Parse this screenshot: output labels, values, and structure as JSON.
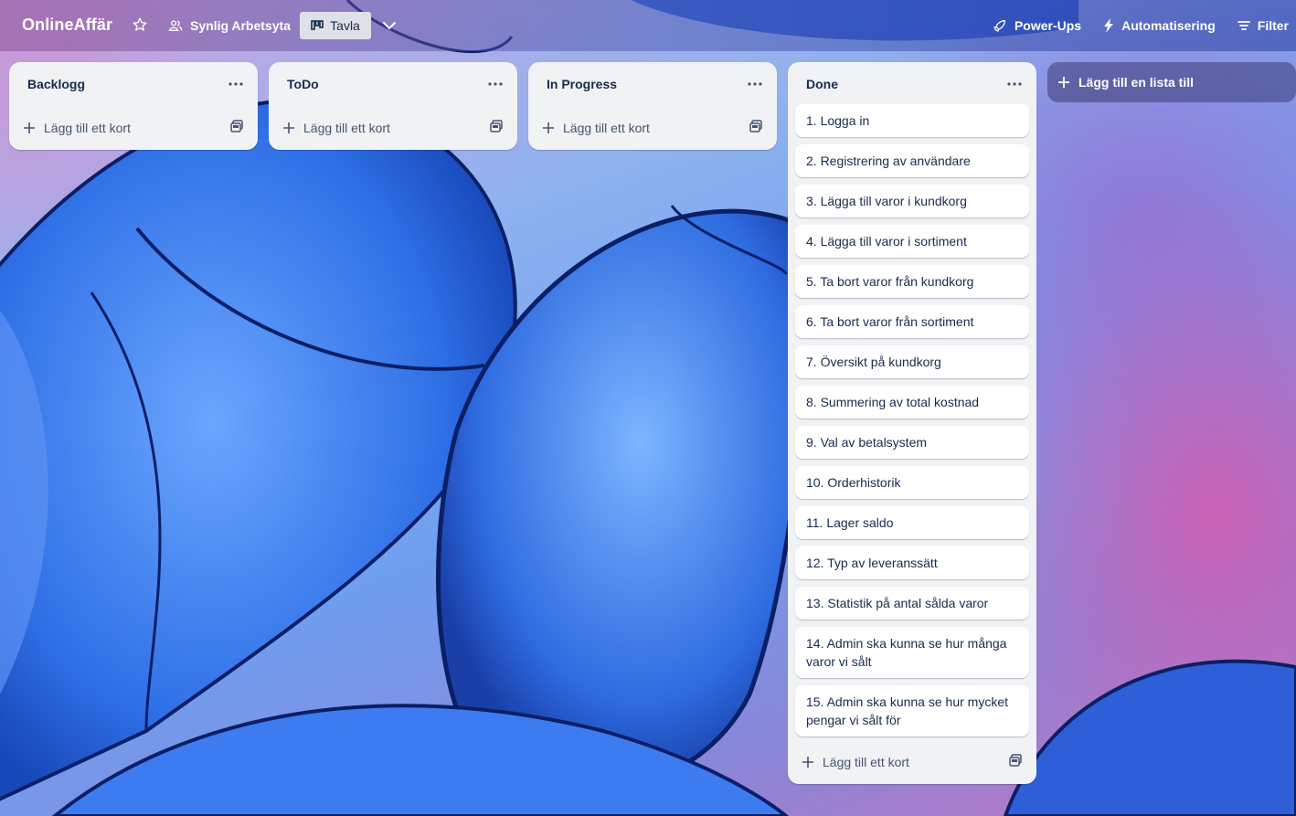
{
  "header": {
    "board_title": "OnlineAffär",
    "visibility_label": "Synlig Arbetsyta",
    "view_label": "Tavla",
    "powerups_label": "Power-Ups",
    "automation_label": "Automatisering",
    "filter_label": "Filter"
  },
  "lists": [
    {
      "title": "Backlogg",
      "add_card_label": "Lägg till ett kort",
      "cards": []
    },
    {
      "title": "ToDo",
      "add_card_label": "Lägg till ett kort",
      "cards": []
    },
    {
      "title": "In Progress",
      "add_card_label": "Lägg till ett kort",
      "cards": []
    },
    {
      "title": "Done",
      "add_card_label": "Lägg till ett kort",
      "cards": [
        "1. Logga in",
        "2. Registrering av användare",
        "3. Lägga till varor i kundkorg",
        "4. Lägga till varor i sortiment",
        "5. Ta bort varor från kundkorg",
        "6. Ta bort varor från sortiment",
        "7. Översikt på kundkorg",
        "8. Summering av total kostnad",
        "9. Val av betalsystem",
        "10. Orderhistorik",
        "11. Lager saldo",
        "12. Typ av leveranssätt",
        "13. Statistik på antal sålda varor",
        "14. Admin ska kunna se hur många varor vi sålt",
        "15. Admin ska kunna se hur mycket pengar vi sålt för"
      ]
    }
  ],
  "add_list_label": "Lägg till en lista till",
  "colors": {
    "list_bg": "#f1f2f4",
    "card_bg": "#ffffff",
    "text": "#172b4d",
    "muted": "#44546f"
  }
}
